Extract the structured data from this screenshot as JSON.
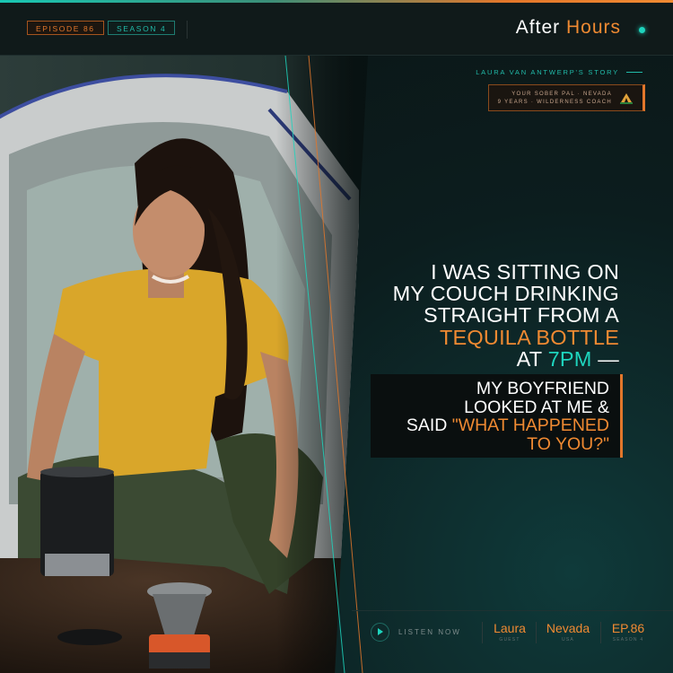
{
  "header": {
    "episode_badge": "EPISODE 86",
    "season_badge": "SEASON 4",
    "brand_main": "After",
    "brand_accent": "Hours",
    "accent_color": "#f08a32",
    "teal_color": "#1ed4bd"
  },
  "story": {
    "title": "LAURA VAN ANTWERP'S STORY",
    "info_line1": "YOUR SOBER PAL · NEVADA",
    "info_line2": "9 YEARS · WILDERNESS COACH",
    "info_icon": "tent-campfire-icon"
  },
  "quote": {
    "line1": "I WAS SITTING ON",
    "line2": "MY COUCH DRINKING",
    "line3": "STRAIGHT FROM A",
    "line4_highlight": "TEQUILA BOTTLE",
    "line5_pre": "AT",
    "line5_highlight": "7PM",
    "line5_post": "—",
    "box_line1": "MY BOYFRIEND",
    "box_line2": "LOOKED AT ME &",
    "box_line3_pre": "SAID",
    "box_line3_highlight": "\"WHAT HAPPENED",
    "box_line4_highlight": "TO YOU?\""
  },
  "footer": {
    "listen_label": "LISTEN NOW",
    "play_icon": "play-icon",
    "stats": [
      {
        "value": "Laura",
        "sub": "GUEST"
      },
      {
        "value": "Nevada",
        "sub": "USA"
      },
      {
        "value": "EP.86",
        "sub": "SEASON 4"
      }
    ]
  }
}
